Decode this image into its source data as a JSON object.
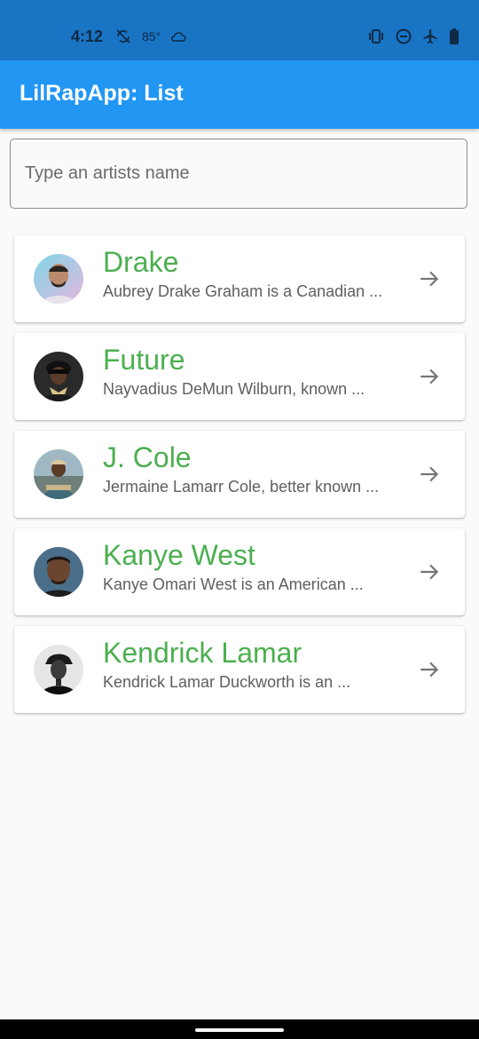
{
  "status_bar": {
    "time": "4:12",
    "temperature": "85°",
    "icons_left": [
      "sync-off-icon",
      "cloud-icon"
    ],
    "icons_right": [
      "vibrate-icon",
      "do-not-disturb-icon",
      "airplane-mode-icon",
      "battery-icon"
    ]
  },
  "app_bar": {
    "title": "LilRapApp: List"
  },
  "search": {
    "value": "",
    "placeholder": "Type an artists name"
  },
  "artists": [
    {
      "name": "Drake",
      "description": "Aubrey Drake Graham is a Canadian ...",
      "icon": "arrow-forward-icon"
    },
    {
      "name": "Future",
      "description": "Nayvadius DeMun Wilburn, known ...",
      "icon": "arrow-forward-icon"
    },
    {
      "name": "J. Cole",
      "description": "Jermaine Lamarr Cole, better known ...",
      "icon": "arrow-forward-icon"
    },
    {
      "name": "Kanye West",
      "description": "Kanye Omari West is an American ...",
      "icon": "arrow-forward-icon"
    },
    {
      "name": "Kendrick Lamar",
      "description": "Kendrick Lamar Duckworth is an ...",
      "icon": "arrow-forward-icon"
    }
  ],
  "colors": {
    "status_bar": "#1a74c4",
    "app_bar": "#2196f3",
    "artist_name": "#4caf50",
    "background": "#fafafa"
  }
}
